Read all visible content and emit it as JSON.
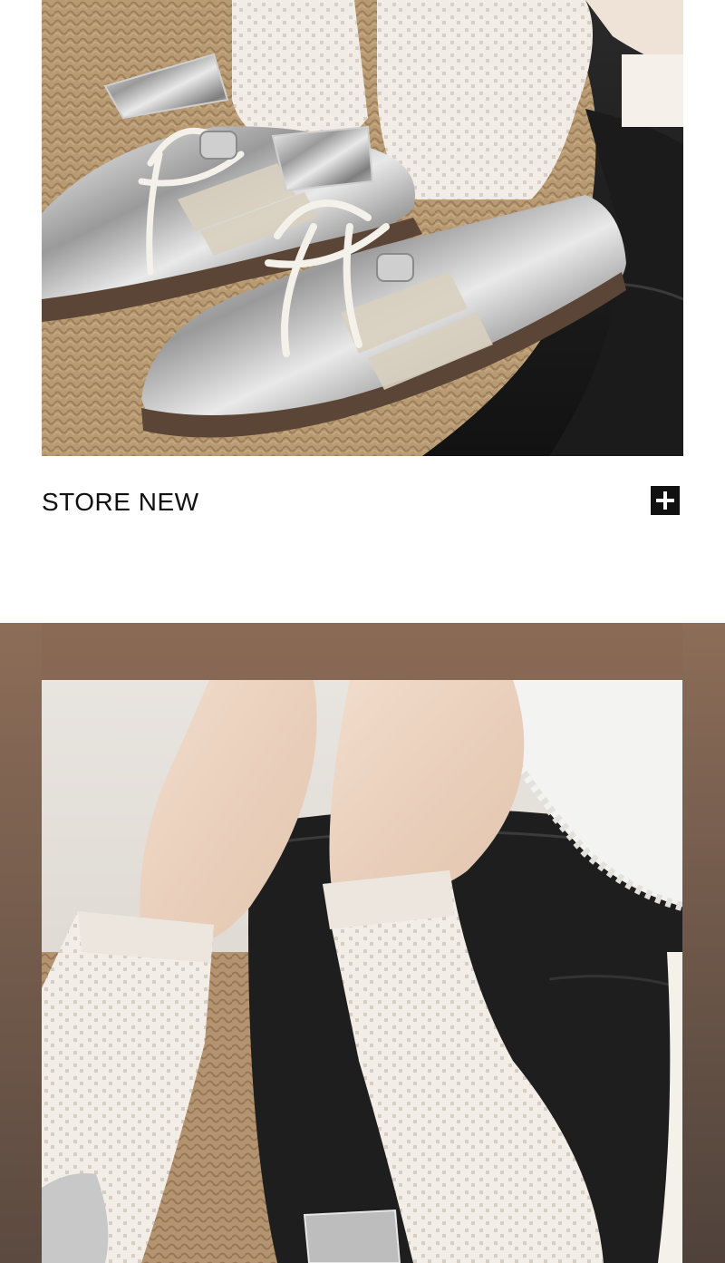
{
  "store": {
    "label": "STORE NEW"
  },
  "icons": {
    "expand": "plus-icon"
  },
  "colors": {
    "text": "#111111",
    "button_bg": "#111111",
    "frame": "#7c604e"
  }
}
